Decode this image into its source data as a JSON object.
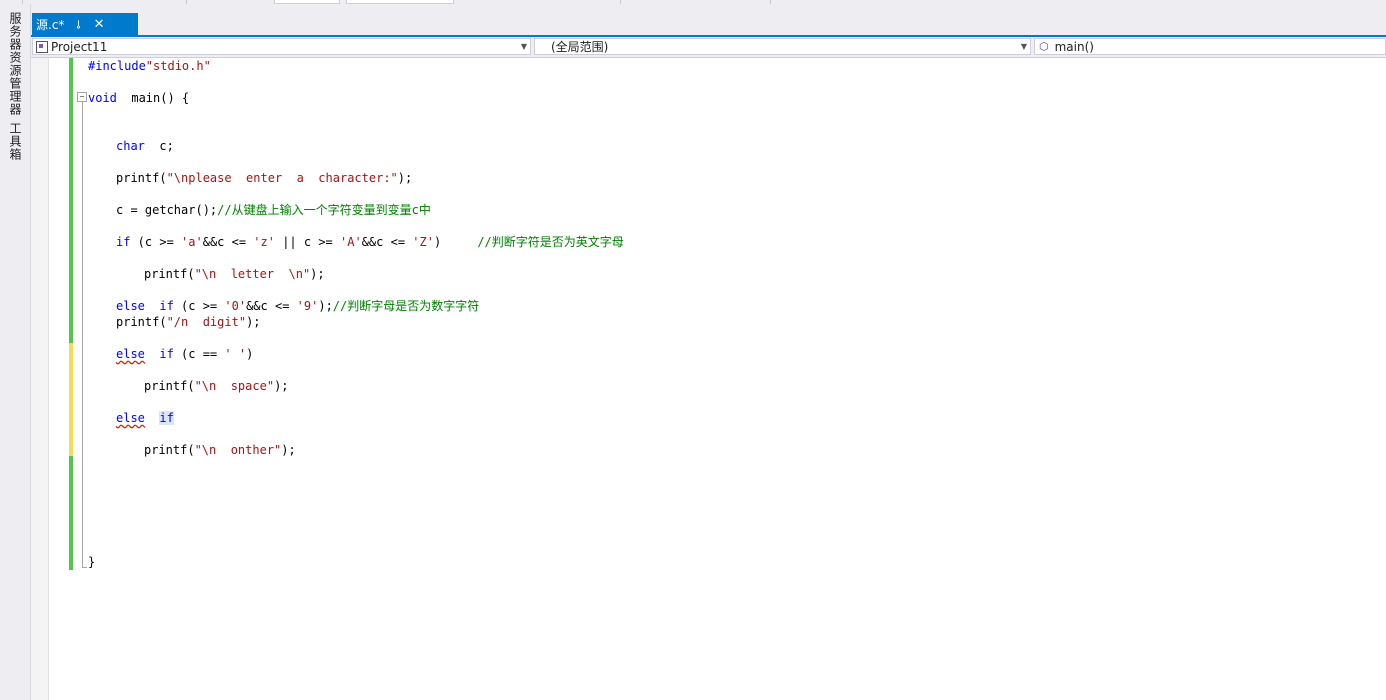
{
  "tab": {
    "title": "源.c*",
    "pin_glyph": "⊸",
    "close_glyph": "✕"
  },
  "sidebar": {
    "tabs": [
      "服务器资源管理器",
      "工具箱"
    ]
  },
  "navbar": {
    "project": "Project11",
    "scope": "(全局范围)",
    "member": "main()"
  },
  "editor": {
    "lines": [
      {
        "row": 0,
        "indent": 0,
        "tokens": [
          {
            "t": "#include",
            "c": "pp"
          },
          {
            "t": "\"stdio.h\"",
            "c": "str"
          }
        ]
      },
      {
        "row": 2,
        "indent": 0,
        "tokens": [
          {
            "t": "void",
            "c": "kw"
          },
          {
            "t": "  main() {",
            "c": ""
          }
        ]
      },
      {
        "row": 5,
        "indent": 1,
        "tokens": [
          {
            "t": "char",
            "c": "kw"
          },
          {
            "t": "  c;",
            "c": ""
          }
        ]
      },
      {
        "row": 7,
        "indent": 1,
        "tokens": [
          {
            "t": "printf(",
            "c": ""
          },
          {
            "t": "\"\\nplease  enter  a  character:\"",
            "c": "str"
          },
          {
            "t": ");",
            "c": ""
          }
        ]
      },
      {
        "row": 9,
        "indent": 1,
        "tokens": [
          {
            "t": "c = getchar();",
            "c": ""
          },
          {
            "t": "//从键盘上输入一个字符变量到变量c中",
            "c": "cm"
          }
        ]
      },
      {
        "row": 11,
        "indent": 1,
        "tokens": [
          {
            "t": "if",
            "c": "kw"
          },
          {
            "t": " (c >= ",
            "c": ""
          },
          {
            "t": "'a'",
            "c": "str"
          },
          {
            "t": "&&c <= ",
            "c": ""
          },
          {
            "t": "'z'",
            "c": "str"
          },
          {
            "t": " || c >= ",
            "c": ""
          },
          {
            "t": "'A'",
            "c": "str"
          },
          {
            "t": "&&c <= ",
            "c": ""
          },
          {
            "t": "'Z'",
            "c": "str"
          },
          {
            "t": ")     ",
            "c": ""
          },
          {
            "t": "//判断字符是否为英文字母",
            "c": "cm"
          }
        ]
      },
      {
        "row": 13,
        "indent": 2,
        "tokens": [
          {
            "t": "printf(",
            "c": ""
          },
          {
            "t": "\"\\n  letter  \\n\"",
            "c": "str"
          },
          {
            "t": ");",
            "c": ""
          }
        ]
      },
      {
        "row": 15,
        "indent": 1,
        "tokens": [
          {
            "t": "else",
            "c": "kw"
          },
          {
            "t": "  ",
            "c": ""
          },
          {
            "t": "if",
            "c": "kw"
          },
          {
            "t": " (c >= ",
            "c": ""
          },
          {
            "t": "'0'",
            "c": "str"
          },
          {
            "t": "&&c <= ",
            "c": ""
          },
          {
            "t": "'9'",
            "c": "str"
          },
          {
            "t": ");",
            "c": ""
          },
          {
            "t": "//判断字母是否为数字字符",
            "c": "cm"
          }
        ]
      },
      {
        "row": 16,
        "indent": 1,
        "tokens": [
          {
            "t": "printf(",
            "c": ""
          },
          {
            "t": "\"/n  digit\"",
            "c": "str"
          },
          {
            "t": ");",
            "c": ""
          }
        ]
      },
      {
        "row": 18,
        "indent": 1,
        "tokens": [
          {
            "t": "else",
            "c": "kw squig"
          },
          {
            "t": "  ",
            "c": ""
          },
          {
            "t": "if",
            "c": "kw"
          },
          {
            "t": " (c == ",
            "c": ""
          },
          {
            "t": "' '",
            "c": "str"
          },
          {
            "t": ")",
            "c": ""
          }
        ]
      },
      {
        "row": 20,
        "indent": 2,
        "tokens": [
          {
            "t": "printf(",
            "c": ""
          },
          {
            "t": "\"\\n  space\"",
            "c": "str"
          },
          {
            "t": ");",
            "c": ""
          }
        ]
      },
      {
        "row": 22,
        "indent": 1,
        "tokens": [
          {
            "t": "else",
            "c": "kw squig"
          },
          {
            "t": "  ",
            "c": ""
          },
          {
            "t": "if",
            "c": "kw hl"
          }
        ]
      },
      {
        "row": 24,
        "indent": 2,
        "tokens": [
          {
            "t": "printf(",
            "c": ""
          },
          {
            "t": "\"\\n  onther\"",
            "c": "str"
          },
          {
            "t": ");",
            "c": ""
          }
        ]
      },
      {
        "row": 31,
        "indent": 0,
        "tokens": [
          {
            "t": "}",
            "c": ""
          }
        ]
      }
    ]
  },
  "colors": {
    "accent": "#007acc",
    "keyword": "#0000ff",
    "string": "#a31515",
    "comment": "#008000",
    "saved_change": "#57c452",
    "unsaved_change": "#f2dd56"
  }
}
